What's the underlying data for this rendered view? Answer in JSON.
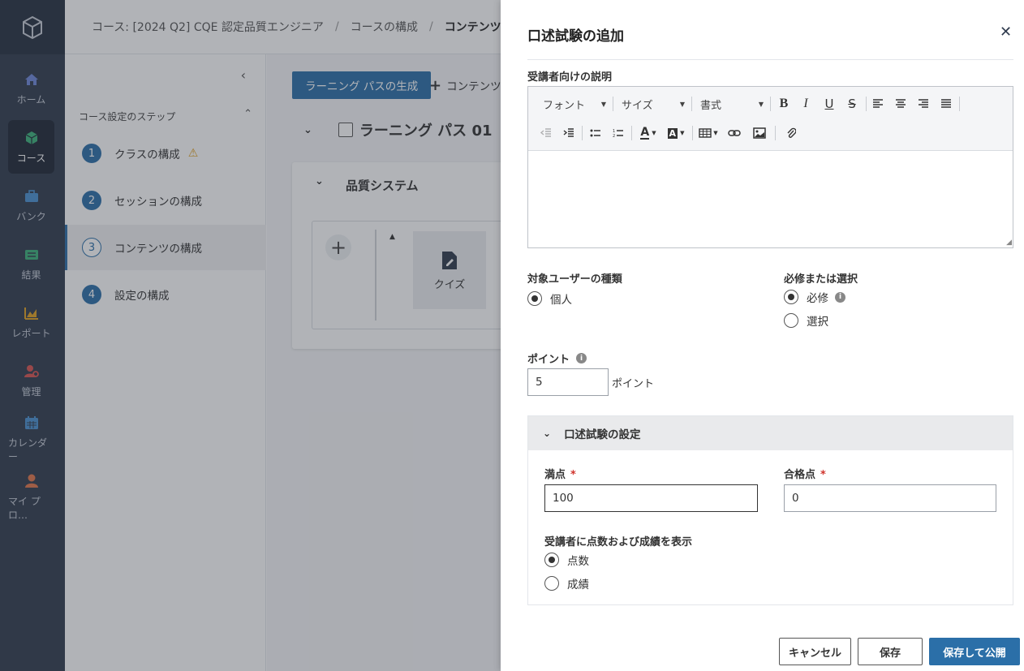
{
  "nav": {
    "items": [
      {
        "label": "ホーム",
        "icon": "home-icon"
      },
      {
        "label": "コース",
        "icon": "cube-icon"
      },
      {
        "label": "バンク",
        "icon": "briefcase-icon"
      },
      {
        "label": "結果",
        "icon": "list-icon"
      },
      {
        "label": "レポート",
        "icon": "chart-icon"
      },
      {
        "label": "管理",
        "icon": "admin-icon"
      },
      {
        "label": "カレンダー",
        "icon": "calendar-icon"
      },
      {
        "label": "マイ プロ…",
        "icon": "person-icon"
      }
    ]
  },
  "breadcrumb": {
    "course": "コース: [2024 Q2] CQE 認定品質エンジニア",
    "config": "コースの構成",
    "current": "コンテンツの構成"
  },
  "steps": {
    "header": "コース設定のステップ",
    "items": [
      {
        "num": "1",
        "label": "クラスの構成"
      },
      {
        "num": "2",
        "label": "セッションの構成"
      },
      {
        "num": "3",
        "label": "コンテンツの構成"
      },
      {
        "num": "4",
        "label": "設定の構成"
      }
    ]
  },
  "content": {
    "generate_button": "ラーニング パスの生成",
    "add_content": "コンテンツ ク",
    "learning_path": "ラーニング パス 01",
    "card_title": "品質システム",
    "quiz_label": "クイズ"
  },
  "panel": {
    "title": "口述試験の追加",
    "description_label": "受講者向けの説明",
    "toolbar": {
      "font": "フォント",
      "size": "サイズ",
      "format": "書式"
    },
    "user_type_label": "対象ユーザーの種類",
    "user_type_option": "個人",
    "required_label": "必修または選択",
    "required_option": "必修",
    "optional_option": "選択",
    "points_label": "ポイント",
    "points_value": "5",
    "points_unit": "ポイント",
    "settings": {
      "title": "口述試験の設定",
      "max_score_label": "満点",
      "max_score_value": "100",
      "pass_score_label": "合格点",
      "pass_score_value": "0",
      "display_label": "受講者に点数および成績を表示",
      "score_option": "点数",
      "grade_option": "成績"
    },
    "buttons": {
      "cancel": "キャンセル",
      "save": "保存",
      "save_publish": "保存して公開"
    }
  },
  "colors": {
    "primary": "#2b6fa8",
    "nav_bg": "#2f3a4d",
    "required": "#d0342c",
    "warning": "#e0a020"
  }
}
